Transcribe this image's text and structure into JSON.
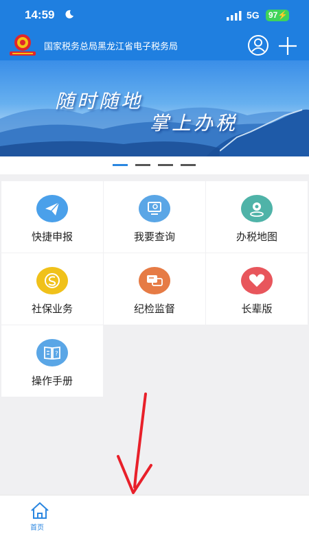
{
  "status_bar": {
    "time": "14:59",
    "network": "5G",
    "battery": "97"
  },
  "header": {
    "title": "国家税务总局黑龙江省电子税务局",
    "icons": [
      "emblem-logo",
      "user-icon",
      "plus-icon"
    ]
  },
  "banner": {
    "line1": "随时随地",
    "line2": "掌上办税",
    "slides": 4,
    "active_slide": 0
  },
  "menu": [
    {
      "label": "快捷申报",
      "icon": "paper-plane-icon",
      "color": "#4aa0ea"
    },
    {
      "label": "我要查询",
      "icon": "monitor-search-icon",
      "color": "#5aa6e6"
    },
    {
      "label": "办税地图",
      "icon": "map-pin-icon",
      "color": "#4fb3a8"
    },
    {
      "label": "社保业务",
      "icon": "social-security-icon",
      "color": "#f0c11a"
    },
    {
      "label": "纪检监督",
      "icon": "chat-bubble-icon",
      "color": "#e67b45"
    },
    {
      "label": "长辈版",
      "icon": "heart-icon",
      "color": "#e8565c"
    },
    {
      "label": "操作手册",
      "icon": "book-icon",
      "color": "#5aa6e6"
    }
  ],
  "tabbar": {
    "home_label": "首页"
  },
  "colors": {
    "brand": "#1f7fe0",
    "background": "#f0f0f2",
    "annotation_arrow": "#e8202a"
  }
}
